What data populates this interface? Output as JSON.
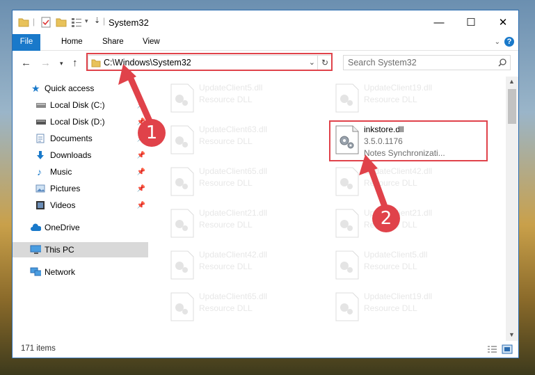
{
  "window": {
    "title": "System32",
    "caption_buttons": {
      "minimize": "—",
      "maximize": "☐",
      "close": "✕"
    }
  },
  "ribbon": {
    "tabs": [
      "File",
      "Home",
      "Share",
      "View"
    ],
    "help": "?"
  },
  "address": {
    "path": "C:\\Windows\\System32",
    "search_placeholder": "Search System32"
  },
  "nav": {
    "items": [
      {
        "label": "Quick access",
        "icon": "star-icon",
        "pinned": false
      },
      {
        "label": "Local Disk (C:)",
        "icon": "drive-icon",
        "pinned": true
      },
      {
        "label": "Local Disk (D:)",
        "icon": "drive-icon",
        "pinned": true
      },
      {
        "label": "Documents",
        "icon": "documents-icon",
        "pinned": true
      },
      {
        "label": "Downloads",
        "icon": "download-icon",
        "pinned": true
      },
      {
        "label": "Music",
        "icon": "music-icon",
        "pinned": true
      },
      {
        "label": "Pictures",
        "icon": "pictures-icon",
        "pinned": true
      },
      {
        "label": "Videos",
        "icon": "videos-icon",
        "pinned": true
      },
      {
        "label": "OneDrive",
        "icon": "cloud-icon",
        "pinned": false
      },
      {
        "label": "This PC",
        "icon": "computer-icon",
        "pinned": false,
        "selected": true
      },
      {
        "label": "Network",
        "icon": "network-icon",
        "pinned": false
      }
    ]
  },
  "files": {
    "left": [
      {
        "name": "UpdateClient5.dll",
        "desc": "Resource DLL"
      },
      {
        "name": "UpdateClient63.dll",
        "desc": "Resource DLL"
      },
      {
        "name": "UpdateClient65.dll",
        "desc": "Resource DLL"
      },
      {
        "name": "UpdateClient21.dll",
        "desc": "Resource DLL"
      },
      {
        "name": "UpdateClient42.dll",
        "desc": "Resource DLL"
      },
      {
        "name": "UpdateClient65.dll",
        "desc": "Resource DLL"
      }
    ],
    "right": [
      {
        "name": "UpdateClient19.dll",
        "desc": "Resource DLL"
      },
      {
        "name": "UpdateClient42.dll",
        "desc": "Resource DLL"
      },
      {
        "name": "UpdateClient21.dll",
        "desc": "Resource DLL"
      },
      {
        "name": "UpdateClient5.dll",
        "desc": "Resource DLL"
      },
      {
        "name": "UpdateClient19.dll",
        "desc": "Resource DLL"
      }
    ],
    "highlighted": {
      "name": "inkstore.dll",
      "version": "3.5.0.1176",
      "desc": "Notes Synchronizati..."
    }
  },
  "status": {
    "item_count": "171 items"
  },
  "callouts": {
    "one": "1",
    "two": "2"
  },
  "colors": {
    "accent": "#1979ca",
    "callout": "#e0424a"
  }
}
